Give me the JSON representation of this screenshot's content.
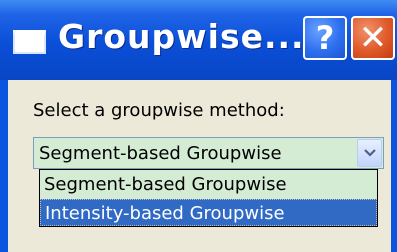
{
  "window": {
    "title": "Groupwise...",
    "help_glyph": "?",
    "close_glyph": "✕"
  },
  "dialog": {
    "prompt": "Select a groupwise method:",
    "combo": {
      "selected": "Segment-based Groupwise",
      "arrow_glyph": "⌄",
      "options": [
        "Segment-based Groupwise",
        "Intensity-based Groupwise"
      ],
      "highlighted_option": "Intensity-based Groupwise"
    }
  },
  "colors": {
    "titlebar": "#0a4fd8",
    "client_bg": "#ece9d8",
    "combo_bg": "#d4ecd4",
    "highlight": "#316ac5"
  },
  "icons": [
    "window-icon",
    "help-icon",
    "close-icon",
    "dropdown-arrow-icon"
  ]
}
